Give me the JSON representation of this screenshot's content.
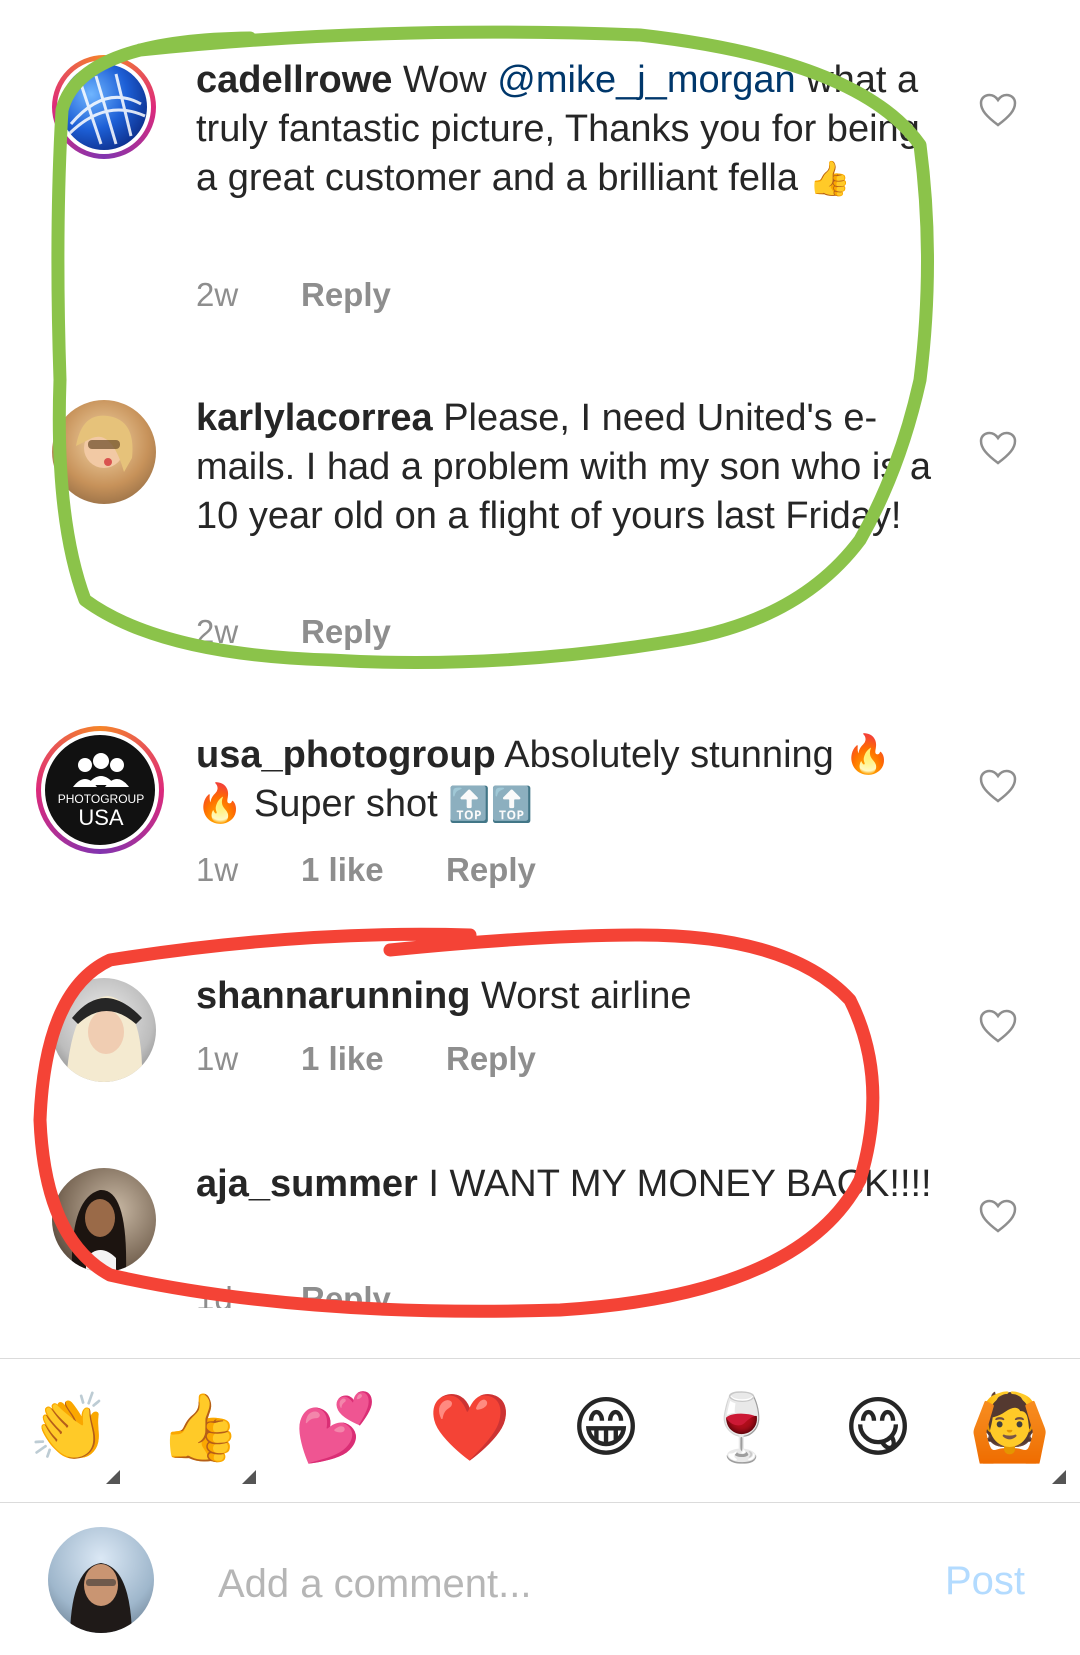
{
  "comments": [
    {
      "username": "cadellrowe",
      "pre_text": " Wow ",
      "mention": "@mike_j_morgan",
      "text": " what a truly fantastic picture, Thanks you for being a great customer and a brilliant fella ",
      "emoji": "👍",
      "time": "2w",
      "likes": "",
      "reply": "Reply"
    },
    {
      "username": "karlylacorrea",
      "text": " Please, I need United's e-mails.  I had a problem with my son who is a 10 year old on a flight of yours last Friday!",
      "time": "2w",
      "likes": "",
      "reply": "Reply"
    },
    {
      "username": "usa_photogroup",
      "text": " Absolutely stunning 🔥 🔥 Super shot ",
      "emoji": "🔝🔝",
      "time": "1w",
      "likes": "1 like",
      "reply": "Reply",
      "avatar_text_1": "PHOTOGROUP",
      "avatar_text_2": "USA"
    },
    {
      "username": "shannarunning",
      "text": " Worst airline",
      "time": "1w",
      "likes": "1 like",
      "reply": "Reply"
    },
    {
      "username": "aja_summer",
      "text": " I WANT MY MONEY BACK!!!!",
      "time": "1d",
      "likes": "",
      "reply": "Reply"
    }
  ],
  "emoji_bar": [
    "👏",
    "👍",
    "💕",
    "❤️",
    "😁",
    "🍷",
    "😋",
    "🙆"
  ],
  "composer": {
    "placeholder": "Add a comment...",
    "post_label": "Post"
  },
  "colors": {
    "green_scribble": "#8bc34a",
    "red_scribble": "#f44336",
    "mention": "#00376b",
    "meta": "#8e8e8e",
    "post_disabled": "#b3dbff"
  },
  "icons": {
    "like": "heart-outline-icon"
  }
}
